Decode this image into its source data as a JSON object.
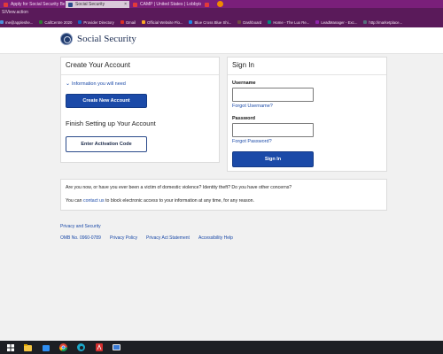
{
  "browser": {
    "tabs": [
      {
        "label": "Apply for Social Security Benefits",
        "active": false
      },
      {
        "label": "Social Security",
        "active": true
      },
      {
        "label": "CAMP | United States | Lobbyist",
        "active": false
      },
      {
        "label": "",
        "active": false
      }
    ],
    "url": "SIView.action",
    "bookmarks": [
      {
        "label": "me@appleshe...",
        "color": "#4a90d9"
      },
      {
        "label": "CallCentre 2020",
        "color": "#2e7d32"
      },
      {
        "label": "Provider Directory",
        "color": "#1565c0"
      },
      {
        "label": "Gmail",
        "color": "#d93025"
      },
      {
        "label": "Official Website Flo...",
        "color": "#f9a825"
      },
      {
        "label": "Blue Cross Blue Shi...",
        "color": "#1e88e5"
      },
      {
        "label": "Dashboard",
        "color": "#6d4c41"
      },
      {
        "label": "Home - The Lux Re...",
        "color": "#00897b"
      },
      {
        "label": "LeadManager - Exc...",
        "color": "#8e24aa"
      },
      {
        "label": "http://marketplace...",
        "color": "#546e7a"
      }
    ]
  },
  "header": {
    "site_title": "Social Security"
  },
  "create_account": {
    "title": "Create Your Account",
    "info_toggle": "Information you will need",
    "create_button": "Create New Account",
    "finish_title": "Finish Setting up Your Account",
    "activation_button": "Enter Activation Code"
  },
  "sign_in": {
    "title": "Sign In",
    "username_label": "Username",
    "forgot_username": "Forgot Username?",
    "password_label": "Password",
    "forgot_password": "Forgot Password?",
    "sign_in_button": "Sign In"
  },
  "notice": {
    "question": "Are you now, or have you ever been a victim of domestic violence? Identity theft? Do you have other concerns?",
    "prefix": "You can ",
    "link": "contact us",
    "suffix": " to block electronic access to your information at any time, for any reason."
  },
  "footer": {
    "privacy_security": "Privacy and Security",
    "omb": "OMB No. 0960-0789",
    "privacy_policy": "Privacy Policy",
    "privacy_act": "Privacy Act Statement",
    "accessibility": "Accessibility Help"
  },
  "taskbar": {
    "icons": [
      "windows-start-icon",
      "file-explorer-icon",
      "store-icon",
      "chrome-icon",
      "edge-icon",
      "acrobat-icon",
      "media-icon"
    ]
  },
  "colors": {
    "primary_button": "#1b4aa8",
    "link": "#1b4aa8",
    "tabbar": "#7a1f7a",
    "taskbar": "#1d1f24"
  }
}
